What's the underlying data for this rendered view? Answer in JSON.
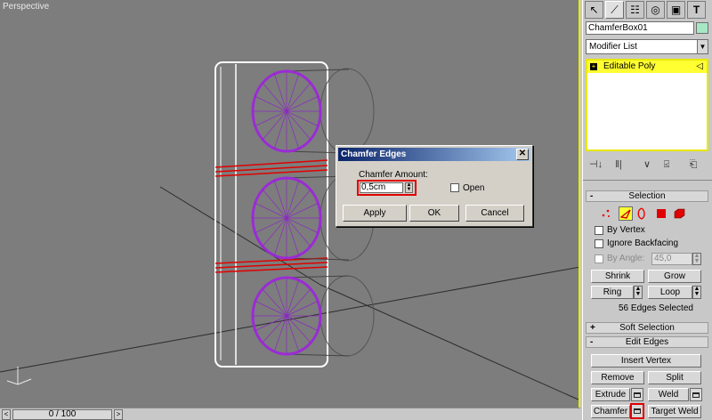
{
  "viewport": {
    "label": "Perspective"
  },
  "timeline": {
    "slider_text": "0 / 100",
    "left_arrow": "<",
    "right_arrow": ">"
  },
  "command_panel": {
    "tabs": [
      {
        "icon": "create-icon",
        "glyph": "↖"
      },
      {
        "icon": "modify-icon",
        "glyph": "⟋"
      },
      {
        "icon": "hierarchy-icon",
        "glyph": "☷"
      },
      {
        "icon": "motion-icon",
        "glyph": "◎"
      },
      {
        "icon": "display-icon",
        "glyph": "▣"
      },
      {
        "icon": "utilities-icon",
        "glyph": "T"
      }
    ],
    "object_name": "ChamferBox01",
    "object_color": "#a7e8c4",
    "modifier_list": {
      "label": "Modifier List",
      "arrow": "▼"
    },
    "stack": {
      "item_label": "Editable Poly",
      "expand": "+",
      "subobject_glyph": "◁",
      "highlight": "#ffff32"
    },
    "stack_tools": [
      "⊣↓",
      "‖|",
      "∨",
      "⍃",
      "⎗"
    ],
    "selection": {
      "title": "Selection",
      "sign": "-",
      "by_vertex": "By Vertex",
      "ignore_backfacing": "Ignore Backfacing",
      "by_angle": "By Angle:",
      "by_angle_value": "45,0",
      "shrink": "Shrink",
      "grow": "Grow",
      "ring": "Ring",
      "loop": "Loop",
      "status": "56 Edges Selected",
      "spin_up": "▲",
      "spin_down": "▼"
    },
    "soft_selection": {
      "title": "Soft Selection",
      "sign": "+"
    },
    "edit_edges": {
      "title": "Edit Edges",
      "sign": "-",
      "insert_vertex": "Insert Vertex",
      "remove": "Remove",
      "split": "Split",
      "extrude": "Extrude",
      "weld": "Weld",
      "chamfer": "Chamfer",
      "target_weld": "Target Weld"
    }
  },
  "dialog": {
    "title": "Chamfer Edges",
    "close": "✕",
    "amount_label": "Chamfer Amount:",
    "amount_value": "0,5cm",
    "open_label": "Open",
    "apply": "Apply",
    "ok": "OK",
    "cancel": "Cancel",
    "spin_up": "▲",
    "spin_down": "▼"
  },
  "colors": {
    "viewport_bg": "#7d7d7d",
    "selection_purple": "#9b2bd6",
    "chamfer_highlight": "#e00000",
    "active_border": "#e8e800"
  }
}
